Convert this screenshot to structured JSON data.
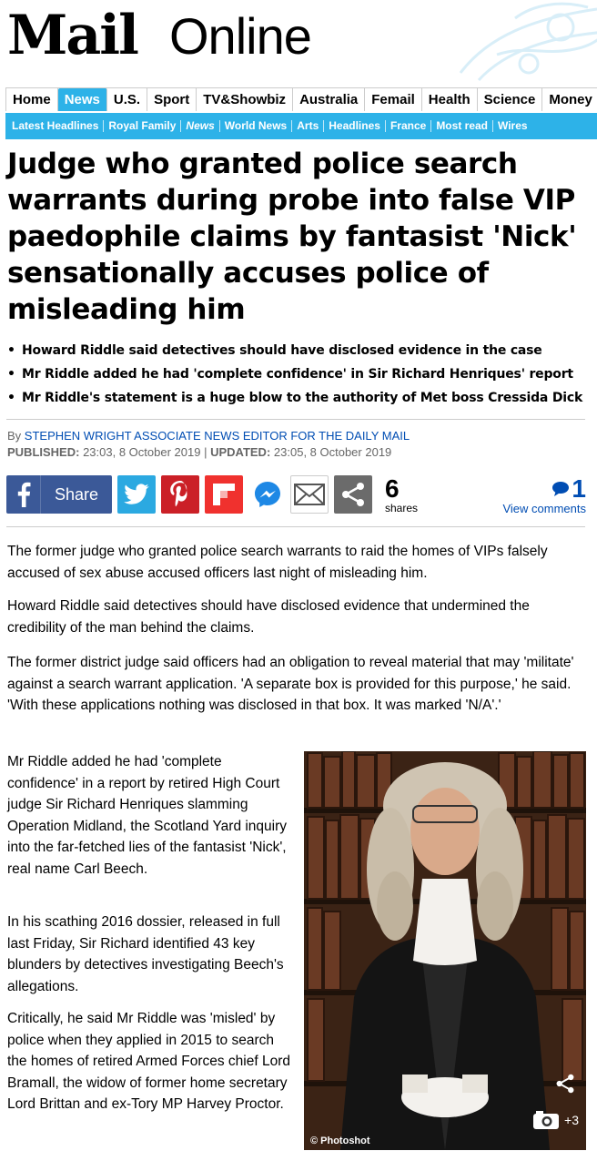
{
  "brand": {
    "logo_mail": "Mail",
    "logo_online": "Online"
  },
  "nav_primary": [
    {
      "label": "Home"
    },
    {
      "label": "News",
      "active": true
    },
    {
      "label": "U.S."
    },
    {
      "label": "Sport"
    },
    {
      "label": "TV&Showbiz"
    },
    {
      "label": "Australia"
    },
    {
      "label": "Femail"
    },
    {
      "label": "Health"
    },
    {
      "label": "Science"
    },
    {
      "label": "Money"
    }
  ],
  "nav_secondary": [
    {
      "label": "Latest Headlines"
    },
    {
      "label": "Royal Family"
    },
    {
      "label": "News",
      "italic": true
    },
    {
      "label": "World News"
    },
    {
      "label": "Arts"
    },
    {
      "label": "Headlines"
    },
    {
      "label": "France"
    },
    {
      "label": "Most read"
    },
    {
      "label": "Wires"
    }
  ],
  "article": {
    "headline": "Judge who granted police search warrants during probe into false VIP paedophile claims by fantasist 'Nick' sensationally accuses police of misleading him",
    "bullets": [
      "Howard Riddle said detectives should have disclosed evidence in the case",
      "Mr Riddle added he had 'complete confidence' in Sir Richard Henriques' report",
      "Mr Riddle's statement is a huge blow to the authority of Met boss Cressida Dick"
    ],
    "byline_prefix": "By",
    "byline_author": "STEPHEN WRIGHT ASSOCIATE NEWS EDITOR FOR THE DAILY MAIL",
    "published_label": "PUBLISHED:",
    "published_value": "23:03, 8 October 2019",
    "updated_label": "UPDATED:",
    "updated_value": "23:05, 8 October 2019",
    "paragraphs": [
      "The former judge who granted police search warrants to raid the homes of VIPs falsely accused of sex abuse accused officers last night of misleading him.",
      "Howard Riddle said detectives should have disclosed evidence that undermined the credibility of the man behind the claims.",
      "The former district judge said officers had an obligation to reveal material that may 'militate' against a search warrant application. 'A separate box is provided for this purpose,' he said. 'With these applications nothing was disclosed in that box. It was marked 'N/A'.'",
      "Mr Riddle added he had 'complete confidence' in a report by retired High Court judge Sir Richard Henriques slamming Operation Midland, the Scotland Yard inquiry into the far-fetched lies of the fantasist 'Nick', real name Carl Beech.",
      "In his scathing 2016 dossier, released in full last Friday, Sir Richard identified 43 key blunders by detectives investigating Beech's allegations.",
      "Critically, he said Mr Riddle was 'misled' by police when they applied in 2015 to search the homes of retired Armed Forces chief Lord Bramall, the widow of former home secretary Lord Brittan and ex-Tory MP Harvey Proctor."
    ]
  },
  "share": {
    "facebook_label": "Share",
    "count": "6",
    "count_label": "shares",
    "comments_count": "1",
    "comments_label": "View comments"
  },
  "photo": {
    "credit": "© Photoshot",
    "gallery_count": "+3"
  },
  "colors": {
    "nav_blue": "#2db2e8",
    "facebook": "#3b5998",
    "twitter": "#2ba9e1",
    "pinterest": "#cb2027",
    "flipboard": "#f0312e",
    "link_blue": "#004db3"
  }
}
